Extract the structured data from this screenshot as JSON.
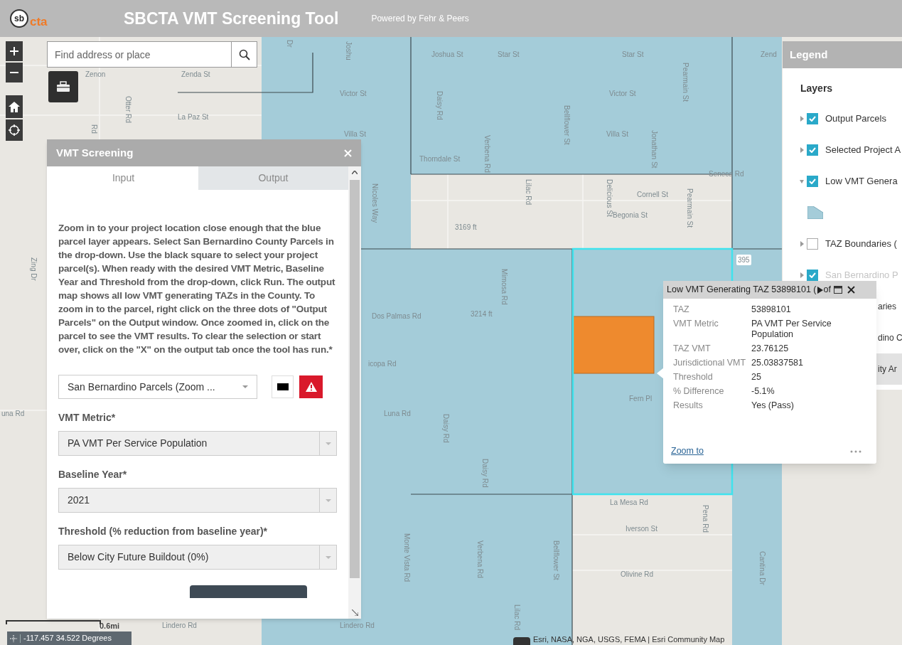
{
  "header": {
    "logo_top": "sb",
    "logo_bottom": "cta",
    "title": "SBCTA VMT Screening Tool",
    "subtitle": "Powered by Fehr & Peers"
  },
  "search": {
    "placeholder": "Find address or place"
  },
  "map": {
    "labels": [
      {
        "text": "Zenon"
      },
      {
        "text": "Zenda St"
      },
      {
        "text": "Dr"
      },
      {
        "text": "Joshu"
      },
      {
        "text": "Joshua St"
      },
      {
        "text": "Star St"
      },
      {
        "text": "Star St"
      },
      {
        "text": "Zend"
      },
      {
        "text": "Victor St"
      },
      {
        "text": "Victor St"
      },
      {
        "text": "Pearmain St"
      },
      {
        "text": "Otter Rd"
      },
      {
        "text": "La Paz St"
      },
      {
        "text": "Villa St"
      },
      {
        "text": "Villa St"
      },
      {
        "text": "Rd"
      },
      {
        "text": "Daisy Rd"
      },
      {
        "text": "Bellflower St"
      },
      {
        "text": "Thorndale St"
      },
      {
        "text": "Verbena Rd"
      },
      {
        "text": "Lilac Rd"
      },
      {
        "text": "Delicious St"
      },
      {
        "text": "Jonathan St"
      },
      {
        "text": "Seneca Rd"
      },
      {
        "text": "Cornell St"
      },
      {
        "text": "Begonia St"
      },
      {
        "text": "Pearmain St"
      },
      {
        "text": "Nicoles Way"
      },
      {
        "text": "3169 ft"
      },
      {
        "text": "Mimosa Rd"
      },
      {
        "text": "Dos Palmas Rd"
      },
      {
        "text": "3214 ft"
      },
      {
        "text": "Zing Dr"
      },
      {
        "text": "icopa Rd"
      },
      {
        "text": "una Rd"
      },
      {
        "text": "Luna Rd"
      },
      {
        "text": "Daisy Rd"
      },
      {
        "text": "Daisy Rd"
      },
      {
        "text": "Fern Pl"
      },
      {
        "text": "La Mesa Rd"
      },
      {
        "text": "Iverson St"
      },
      {
        "text": "Pena Rd"
      },
      {
        "text": "Bellflower St"
      },
      {
        "text": "Monte Vista Rd"
      },
      {
        "text": "Verbena Rd"
      },
      {
        "text": "Olivine Rd"
      },
      {
        "text": "Cantina Dr"
      },
      {
        "text": "Lilac Rd"
      },
      {
        "text": "Lindero Rd"
      },
      {
        "text": "Lindero Rd"
      },
      {
        "text": "395"
      }
    ],
    "scale": "0.6mi",
    "coordinates": "-117.457 34.522 Degrees",
    "attribution": "Esri, NASA, NGA, USGS, FEMA | Esri Community Map"
  },
  "panel": {
    "title": "VMT Screening",
    "tabs": [
      {
        "label": "Input",
        "selected": true
      },
      {
        "label": "Output",
        "selected": false
      }
    ],
    "instructions": "Zoom in to your project location close enough that the blue parcel layer appears. Select San Bernardino County Parcels in the drop-down. Use the black square to select your project parcel(s). When ready with the desired VMT Metric, Baseline Year and Threshold from the drop-down, click Run. The output map shows all low VMT generating TAZs in the County. To zoom in to the parcel, right click on the three dots of \"Output Parcels\" on the Output window. Once zoomed in, click on the parcel to see the VMT results. To clear the selection or start over, click on the \"X\" on the output tab once the tool has run.*",
    "layer_select": "San Bernardino Parcels (Zoom ...",
    "fields": [
      {
        "label": "VMT Metric*",
        "value": "PA VMT Per Service Population"
      },
      {
        "label": "Baseline Year*",
        "value": "2021"
      },
      {
        "label": "Threshold (% reduction from baseline year)*",
        "value": "Below City Future Buildout (0%)"
      }
    ]
  },
  "legend": {
    "title": "Legend",
    "heading": "Layers",
    "items": [
      {
        "kind": "layer",
        "label": "Output Parcels",
        "checked": true,
        "expanded": false,
        "disabled": false
      },
      {
        "kind": "layer",
        "label": "Selected Project A",
        "checked": true,
        "expanded": false,
        "disabled": false
      },
      {
        "kind": "layer",
        "label": "Low VMT Genera",
        "checked": true,
        "expanded": true,
        "disabled": false
      },
      {
        "kind": "symbol"
      },
      {
        "kind": "layer",
        "label": "TAZ Boundaries (",
        "checked": false,
        "expanded": false,
        "disabled": false
      },
      {
        "kind": "layer",
        "label": "San Bernardino P",
        "checked": true,
        "expanded": false,
        "disabled": true
      }
    ],
    "obscured_rows": [
      {
        "label": "aries",
        "selected": false
      },
      {
        "label": "dino C",
        "selected": false
      },
      {
        "label": "ity Ar",
        "selected": true
      }
    ]
  },
  "popup": {
    "title": "Low VMT Generating TAZ 53898101 (",
    "pager": "of",
    "rows": [
      {
        "label": "TAZ",
        "value": "53898101"
      },
      {
        "label": "VMT Metric",
        "value": "PA VMT Per Service Population"
      },
      {
        "label": "TAZ VMT",
        "value": "23.76125"
      },
      {
        "label": "Jurisdictional VMT",
        "value": "25.03837581"
      },
      {
        "label": "Threshold",
        "value": "25"
      },
      {
        "label": "% Difference",
        "value": "-5.1%"
      },
      {
        "label": "Results",
        "value": "Yes (Pass)"
      }
    ],
    "link": "Zoom to"
  }
}
